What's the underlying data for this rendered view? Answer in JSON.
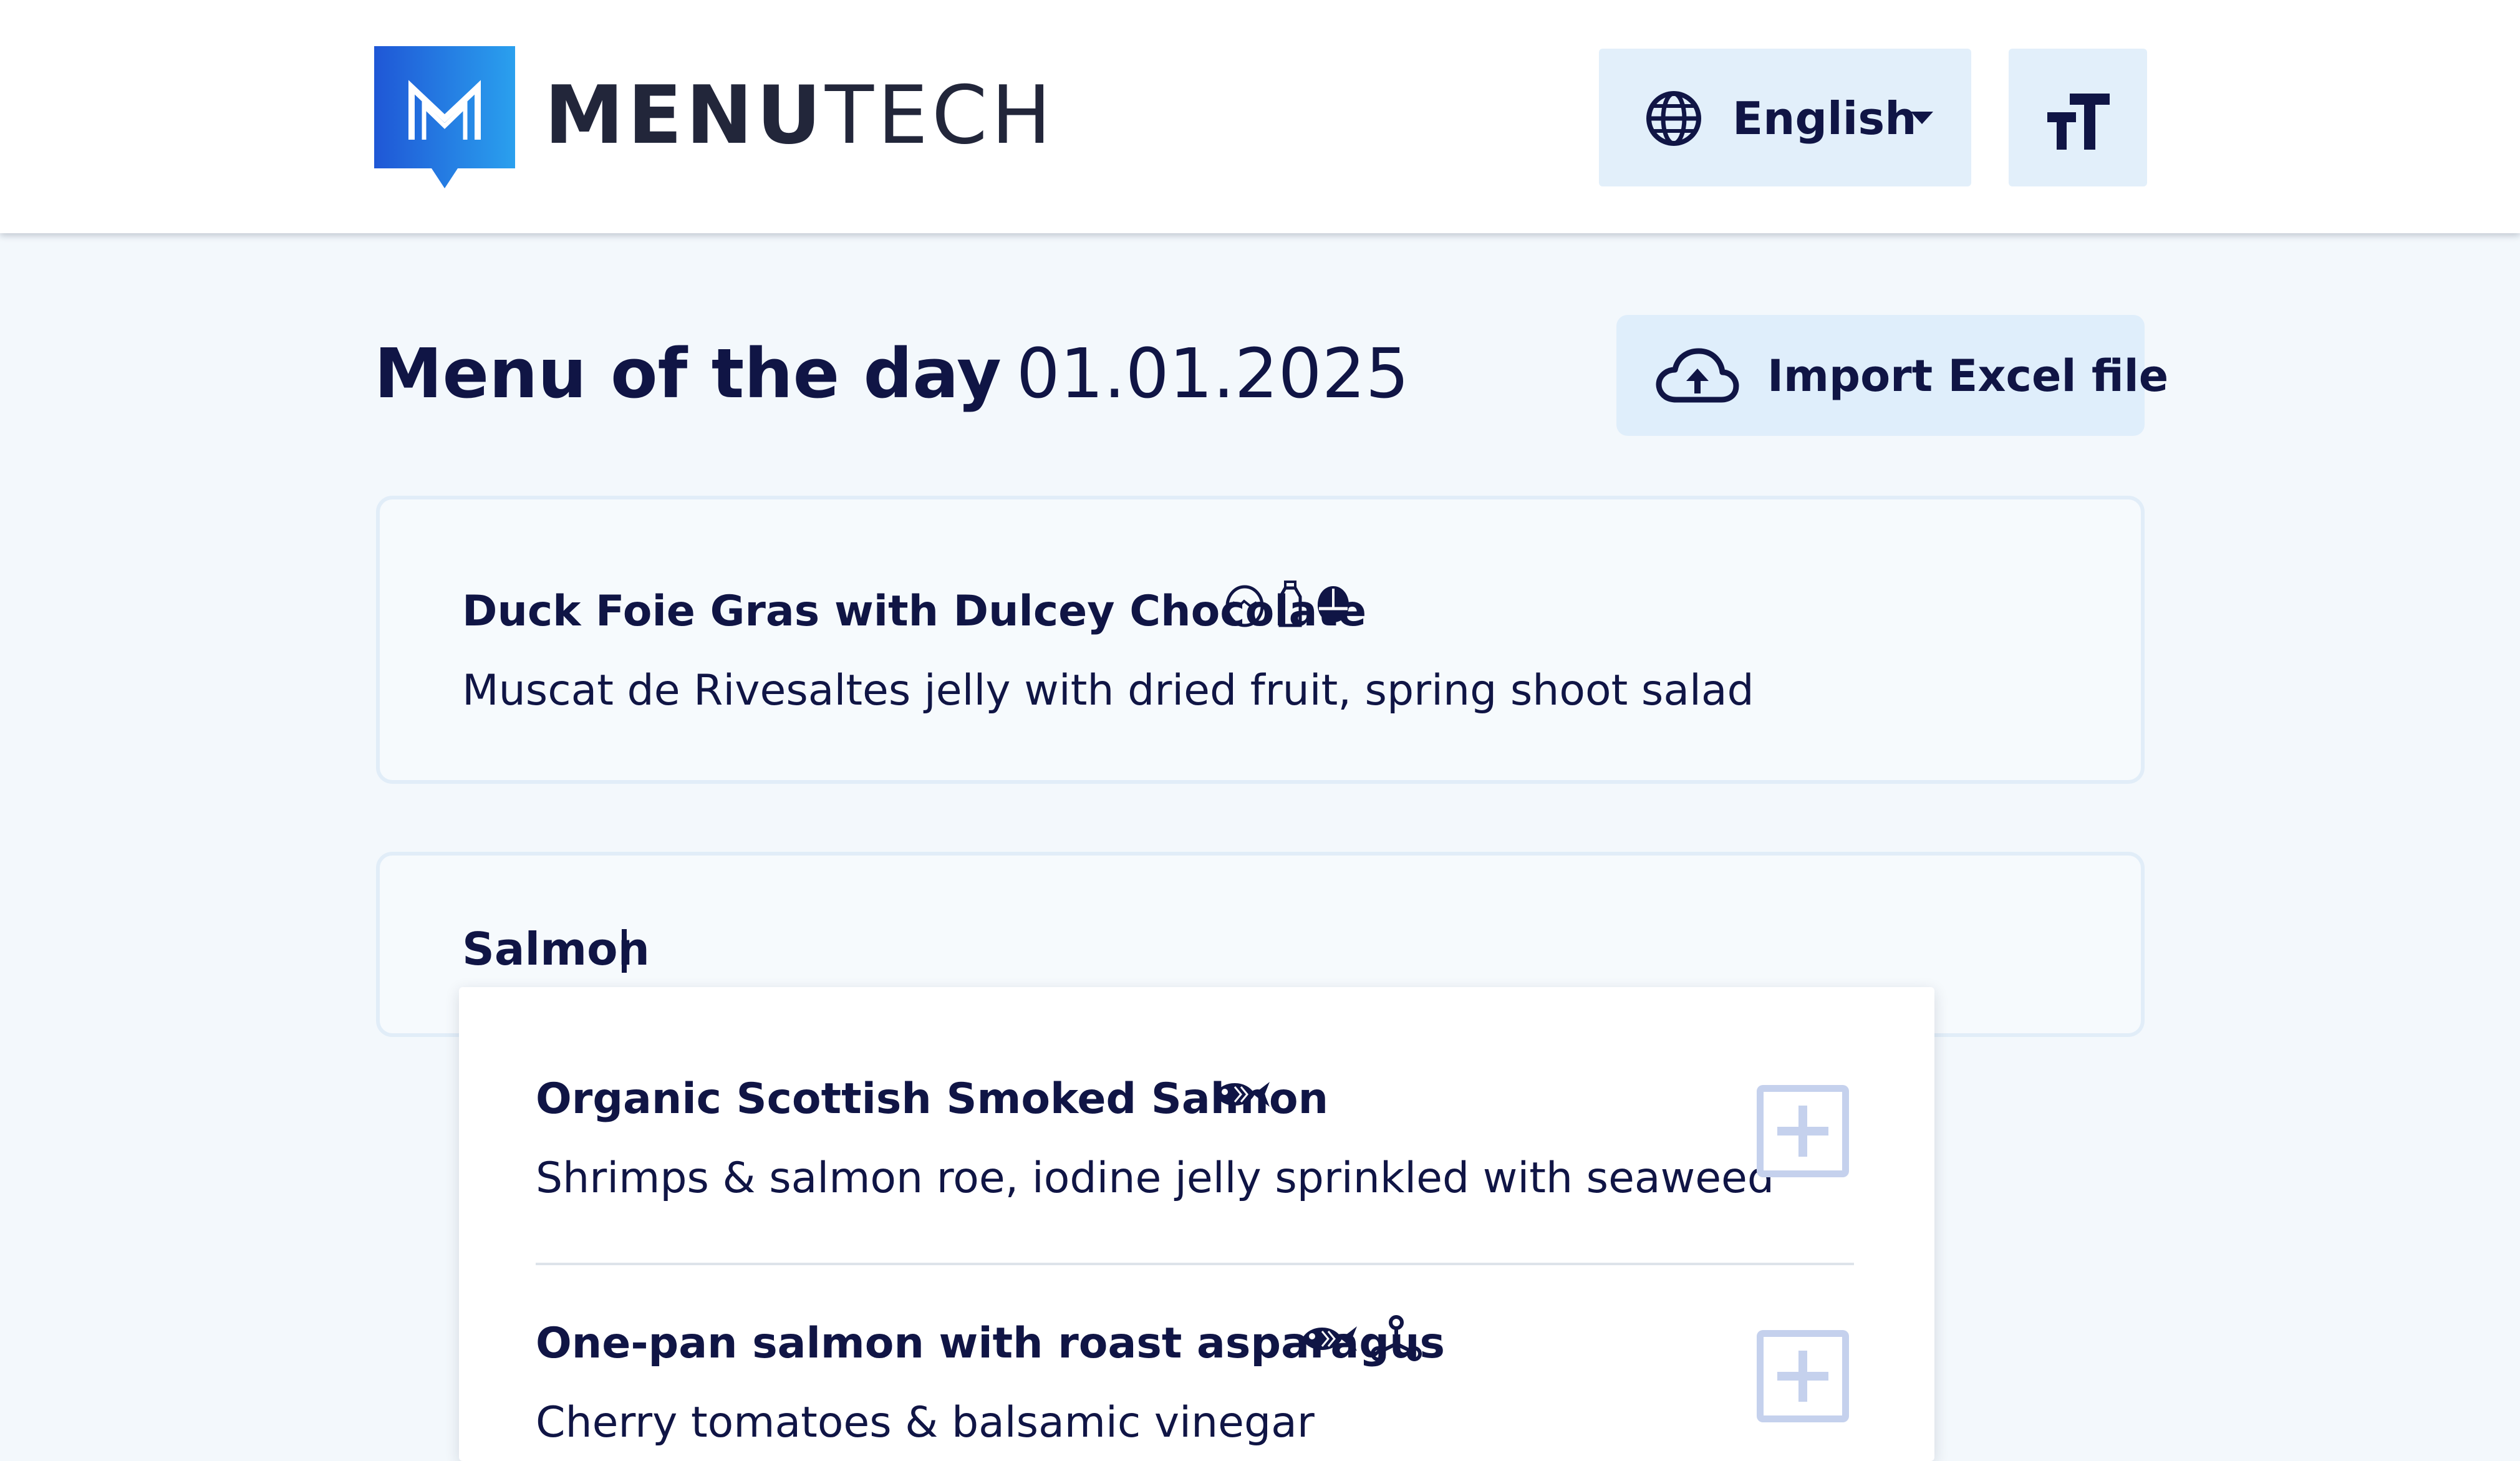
{
  "header": {
    "brand_bold": "MENU",
    "brand_light": "TECH",
    "language": "English",
    "icons": {
      "logo": "menutech-logo",
      "language": "globe-icon",
      "caret": "caret-down-icon",
      "text_size": "text-size-icon"
    }
  },
  "page": {
    "title": "Menu of the day",
    "date": "01.01.2025",
    "import_label": "Import Excel file",
    "import_icon": "cloud-upload-icon"
  },
  "dishes": [
    {
      "name": "Duck Foie Gras with Dulcey Chocolate",
      "description": "Muscat de Rivesaltes jelly with dried fruit, spring shoot salad",
      "allergen_icons": [
        "egg-icon",
        "milk-bottle-icon",
        "nut-icon"
      ]
    }
  ],
  "search": {
    "value": "Salmon "
  },
  "suggestions": [
    {
      "name": "Organic Scottish Smoked Salmon",
      "description": "Shrimps & salmon roe, iodine jelly sprinkled with seaweed",
      "allergen_icons": [
        "fish-icon"
      ]
    },
    {
      "name": "One-pan salmon with roast asparagus",
      "description": "Cherry tomatoes & balsamic vinegar",
      "allergen_icons": [
        "fish-icon",
        "molecule-icon"
      ]
    }
  ],
  "colors": {
    "background": "#f3f8fc",
    "text": "#101545",
    "button_bg": "#e2effa",
    "logo_blue": "#2a6fe0",
    "add_border": "#c5d1ed"
  }
}
